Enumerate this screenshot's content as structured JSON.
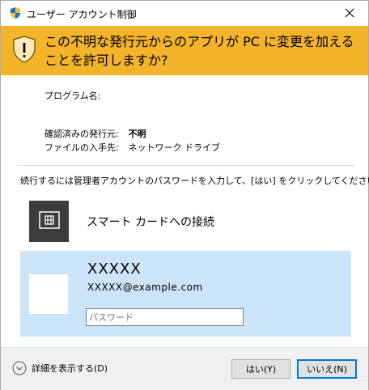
{
  "titlebar": {
    "title": "ユーザー アカウント制御",
    "icon": "uac-shield-icon",
    "close_icon": "close-icon"
  },
  "banner": {
    "text": "この不明な発行元からのアプリが PC に変更を加えることを許可しますか?",
    "icon": "warning-shield-icon",
    "color": "#f3b32a"
  },
  "info": {
    "program_label": "プログラム名:",
    "program_value": "",
    "publisher_label": "確認済みの発行元:",
    "publisher_value": "不明",
    "origin_label": "ファイルの入手先:",
    "origin_value": "ネットワーク ドライブ"
  },
  "instruction": "続行するには管理者アカウントのパスワードを入力して、[はい] をクリックしてください。",
  "smartcard": {
    "label": "スマート カードへの接続",
    "icon": "smart-card-reader-icon"
  },
  "credential": {
    "name": "XXXXX",
    "email": "XXXXX@example.com",
    "password_placeholder": "パスワード",
    "password_value": "",
    "tile_color": "#cce4f7"
  },
  "footer": {
    "details_label": "詳細を表示する(D)",
    "details_icon": "chevron-down-circle-icon",
    "yes_label": "はい(Y)",
    "no_label": "いいえ(N)",
    "accent": "#0078d7"
  }
}
